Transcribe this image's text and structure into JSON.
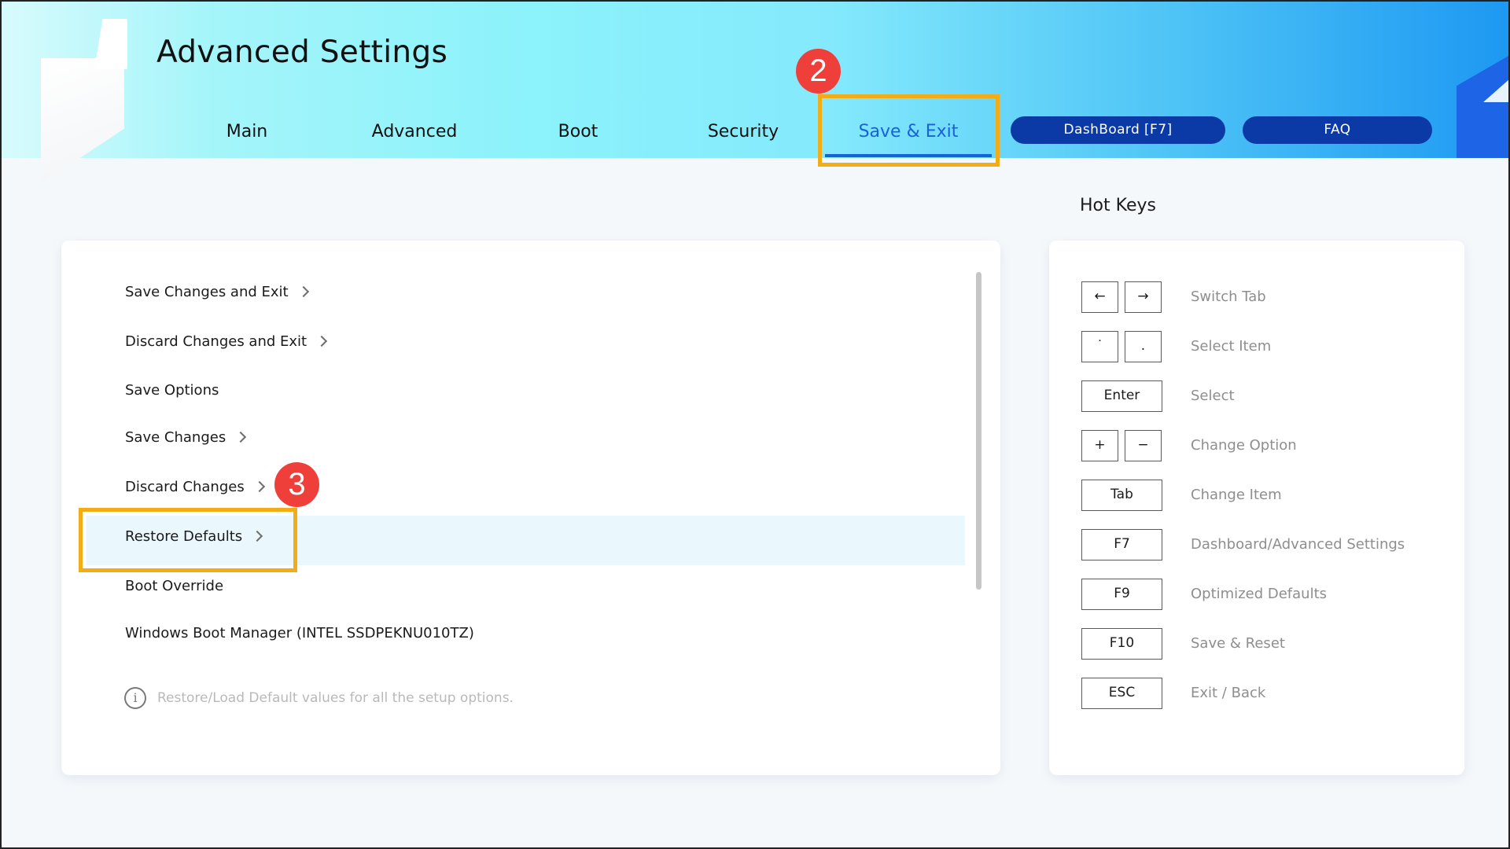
{
  "header": {
    "title": "Advanced Settings",
    "tabs": [
      {
        "label": "Main"
      },
      {
        "label": "Advanced"
      },
      {
        "label": "Boot"
      },
      {
        "label": "Security"
      },
      {
        "label": "Save & Exit"
      }
    ],
    "active_tab": "Save & Exit",
    "dashboard_button": "DashBoard [F7]",
    "faq_button": "FAQ"
  },
  "annotations": {
    "step_2": "2",
    "step_3": "3",
    "highlight_color": "#f2ac16",
    "badge_color": "#ef3f3a"
  },
  "menu": {
    "items": [
      {
        "label": "Save Changes and Exit",
        "chevron": true
      },
      {
        "label": "Discard Changes and Exit",
        "chevron": true
      },
      {
        "label": "Save Options",
        "chevron": false
      },
      {
        "label": "Save Changes",
        "chevron": true
      },
      {
        "label": "Discard Changes",
        "chevron": true
      },
      {
        "label": "Restore Defaults",
        "chevron": true
      },
      {
        "label": "Boot Override",
        "chevron": false
      },
      {
        "label": "Windows Boot Manager (INTEL SSDPEKNU010TZ)",
        "chevron": false
      }
    ],
    "selected_item": "Restore Defaults",
    "help_icon": "info-icon",
    "help_text": "Restore/Load Default values for all the setup options."
  },
  "hotkeys": {
    "title": "Hot Keys",
    "rows": [
      {
        "keys": [
          "←",
          "→"
        ],
        "description": "Switch Tab"
      },
      {
        "keys": [
          "˙",
          "."
        ],
        "description": "Select Item"
      },
      {
        "keys": [
          "Enter"
        ],
        "description": "Select"
      },
      {
        "keys": [
          "+",
          "−"
        ],
        "description": "Change Option"
      },
      {
        "keys": [
          "Tab"
        ],
        "description": "Change Item"
      },
      {
        "keys": [
          "F7"
        ],
        "description": "Dashboard/Advanced Settings"
      },
      {
        "keys": [
          "F9"
        ],
        "description": "Optimized Defaults"
      },
      {
        "keys": [
          "F10"
        ],
        "description": "Save & Reset"
      },
      {
        "keys": [
          "ESC"
        ],
        "description": "Exit / Back"
      }
    ]
  },
  "colors": {
    "accent_blue": "#1662d6",
    "button_navy": "#0b3aa6",
    "selected_row": "#eaf7fd"
  }
}
